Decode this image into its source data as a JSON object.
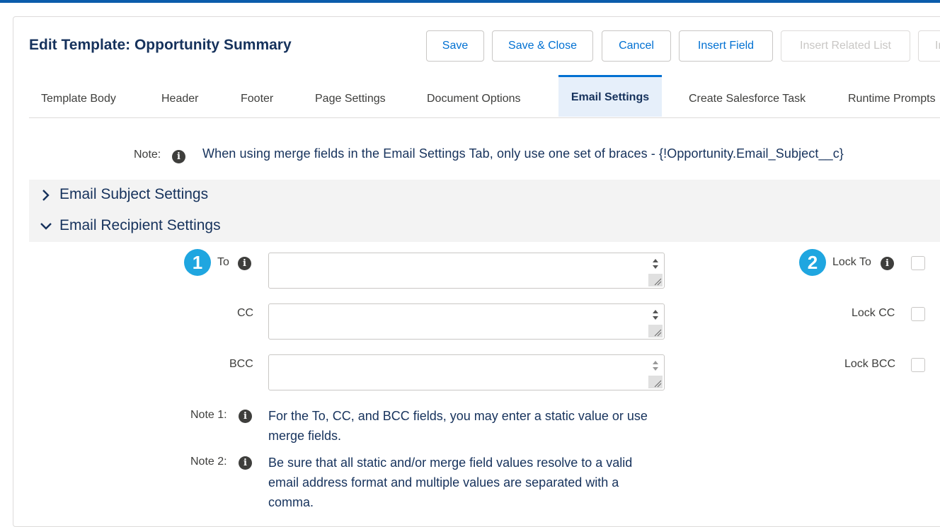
{
  "header": {
    "title": "Edit Template: Opportunity Summary",
    "buttons": {
      "save": "Save",
      "save_close": "Save & Close",
      "cancel": "Cancel",
      "insert_field": "Insert Field",
      "insert_related_list": "Insert Related List",
      "overflow": "In"
    }
  },
  "tabs": [
    {
      "label": "Template Body"
    },
    {
      "label": "Header"
    },
    {
      "label": "Footer"
    },
    {
      "label": "Page Settings"
    },
    {
      "label": "Document Options"
    },
    {
      "label": "Email Settings",
      "active": true
    },
    {
      "label": "Create Salesforce Task"
    },
    {
      "label": "Runtime Prompts"
    }
  ],
  "note": {
    "label": "Note:",
    "text": "When using merge fields in the Email Settings Tab, only use one set of braces - {!Opportunity.Email_Subject__c}"
  },
  "sections": {
    "subject": {
      "title": "Email Subject Settings",
      "expanded": false
    },
    "recipient": {
      "title": "Email Recipient Settings",
      "expanded": true
    }
  },
  "recipient": {
    "to": {
      "label": "To",
      "value": ""
    },
    "cc": {
      "label": "CC",
      "value": ""
    },
    "bcc": {
      "label": "BCC",
      "value": ""
    },
    "lock_to": {
      "label": "Lock To",
      "checked": false
    },
    "lock_cc": {
      "label": "Lock CC",
      "checked": false
    },
    "lock_bcc": {
      "label": "Lock BCC",
      "checked": false
    },
    "badge_1": "1",
    "badge_2": "2",
    "note1": {
      "label": "Note 1:",
      "text": "For the To, CC, and BCC fields, you may enter a static value or use merge fields."
    },
    "note2": {
      "label": "Note 2:",
      "text": "Be sure that all static and/or merge field values resolve to a valid email address format and multiple values are separated with a comma."
    }
  },
  "colors": {
    "accent": "#0070d2",
    "badge": "#1fa6e0",
    "heading": "#16325c",
    "active_tab_bg": "#e6effa"
  }
}
